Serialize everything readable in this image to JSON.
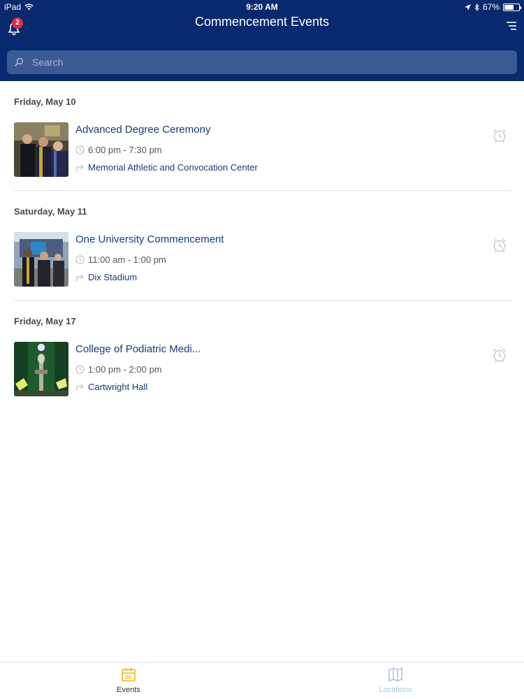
{
  "status_bar": {
    "device": "iPad",
    "time": "9:20 AM",
    "battery": "67%",
    "battery_level": 0.67
  },
  "header": {
    "title": "Commencement Events",
    "notification_count": "2",
    "search_placeholder": "Search"
  },
  "sections": [
    {
      "date": "Friday, May 10",
      "event": {
        "name": "Advanced Degree Ceremony",
        "time": "6:00 pm - 7:30 pm",
        "location": "Memorial Athletic and Convocation Center"
      }
    },
    {
      "date": "Saturday, May 11",
      "event": {
        "name": "One University Commencement",
        "time": "11:00 am - 1:00 pm",
        "location": "Dix Stadium"
      }
    },
    {
      "date": "Friday, May 17",
      "event": {
        "name": "College of Podiatric Medi...",
        "time": "1:00 pm - 2:00 pm",
        "location": "Cartwright Hall"
      }
    }
  ],
  "tabs": {
    "events": "Events",
    "locations": "Locations"
  },
  "colors": {
    "header_bg": "#072a6e",
    "accent_active": "#f0b400",
    "inactive_tab": "#a9c3df",
    "event_title": "#1b3a78"
  },
  "icons": [
    "bell-icon",
    "menu-icon",
    "search-icon",
    "clock-icon",
    "directions-icon",
    "alarm-icon",
    "calendar-icon",
    "map-icon"
  ]
}
